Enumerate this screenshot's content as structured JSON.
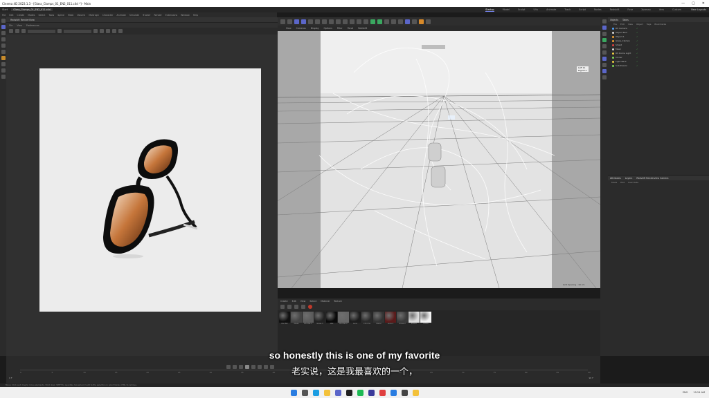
{
  "window": {
    "title": "Cinema 4D 2023.1.3 - [Glass_Clamps_01_EN2_011.c4d *] - Main",
    "controls": [
      "—",
      "▢",
      "✕"
    ]
  },
  "menubar": {
    "items": [
      "File",
      "Edit",
      "Create",
      "Modes",
      "Select",
      "Tools",
      "Spline",
      "Mesh",
      "Volume",
      "MoGraph",
      "Character",
      "Animate",
      "Simulate",
      "Tracker",
      "Render",
      "Extensions",
      "Window",
      "Help"
    ],
    "tabs": [
      "Start",
      "Glass_Clamps_01_EN2_011.c4d"
    ],
    "layout_tabs": [
      "Startup",
      "Model",
      "Sculpt",
      "UVs",
      "Animate",
      "Track",
      "Script",
      "Nodes",
      "Redshift",
      "Fuse",
      "Xpresso",
      "Vers",
      "Custom"
    ],
    "active_layout": "Startup",
    "new_layouts": "New Layouts"
  },
  "render_view": {
    "title": "Redshift RenderView",
    "menu": [
      "File",
      "View",
      "Preferences"
    ],
    "status_text": "Bmp 783/783x800x800 (w/Mo) Progressive 100% Samples 0.0 (Fe)0 100Final 1000 Stats 00:01:53 Total (Object) 0.0 mb ETA 0"
  },
  "viewport": {
    "menu": [
      "View",
      "Cameras",
      "Display",
      "Options",
      "Filter",
      "Panel",
      "Redshift"
    ],
    "label_top": "Default Camera",
    "label_right": [
      "Left 11",
      "Right 11"
    ],
    "zoom": "Grid Spacing : 10 cm"
  },
  "material_manager": {
    "menu": [
      "Create",
      "Edit",
      "View",
      "Select",
      "Material",
      "Texture"
    ],
    "materials": [
      {
        "name": "RS Mat",
        "color": "#111111"
      },
      {
        "name": "Glass",
        "color": "#444444"
      },
      {
        "name": "RS Mat.1",
        "color": "#5b5b5b"
      },
      {
        "name": "Glass.1",
        "color": "#222222"
      },
      {
        "name": "Mat",
        "color": "#0a0a0a"
      },
      {
        "name": "RS Mat.2",
        "color": "#666666"
      },
      {
        "name": "Lens",
        "color": "#1d1d1d"
      },
      {
        "name": "Chrome",
        "color": "#2a2a2a"
      },
      {
        "name": "Metal",
        "color": "#333333"
      },
      {
        "name": "Lens.1",
        "color": "#5a1a1a"
      },
      {
        "name": "Glass.2",
        "color": "#3a3a3a"
      },
      {
        "name": "Plastic",
        "color": "#dddddd"
      },
      {
        "name": "White",
        "color": "#f3f3f3"
      }
    ]
  },
  "objects_panel": {
    "tabs": [
      "Objects",
      "Takes"
    ],
    "menu": [
      "File",
      "Edit",
      "View",
      "Object",
      "Tags",
      "Bookmarks"
    ],
    "rows": [
      {
        "name": "RS Camera",
        "dot": "#4fa3ff"
      },
      {
        "name": "Object Null",
        "dot": "#d9d9d9"
      },
      {
        "name": "Object.1",
        "dot": "#f0a030"
      },
      {
        "name": "Glass_Clamps",
        "dot": "#f0a030"
      },
      {
        "name": "Shield",
        "dot": "#e04040"
      },
      {
        "name": "Mask",
        "dot": "#d9d9d9"
      },
      {
        "name": "RS Dome Light",
        "dot": "#f0d040"
      },
      {
        "name": "Cloner",
        "dot": "#7ed957"
      },
      {
        "name": "Light Back",
        "dot": "#f0d040"
      },
      {
        "name": "Subdivision",
        "dot": "#7ed957"
      }
    ]
  },
  "attributes_panel": {
    "tabs": [
      "Attributes",
      "Layers",
      "Redshift Renderview Camera"
    ],
    "menu": [
      "Mode",
      "Edit",
      "User Data"
    ]
  },
  "timeline": {
    "ticks": [
      "0",
      "5",
      "10",
      "15",
      "20",
      "25",
      "30",
      "35",
      "40",
      "45",
      "50",
      "55",
      "60",
      "65",
      "70",
      "75",
      "80",
      "85",
      "90"
    ],
    "frame_left": "0 F",
    "frame_right": "90 F",
    "status": "Frame 0  Selection Mode"
  },
  "captions": {
    "english": "so honestly this is one of my favorite",
    "chinese": "老实说，这是我最喜欢的一个，"
  },
  "statusbar": {
    "text": "Move: Click and drag to move elements. Hold down SHIFT to quantize movement / add to the selection in point mode, CTRL to remove."
  },
  "taskbar": {
    "icons": [
      {
        "name": "windows",
        "color": "#2a7de1"
      },
      {
        "name": "search",
        "color": "#555555"
      },
      {
        "name": "edge",
        "color": "#1b9de2"
      },
      {
        "name": "explorer",
        "color": "#f3c13a"
      },
      {
        "name": "app1",
        "color": "#5b66c9"
      },
      {
        "name": "app2",
        "color": "#1f1f1f"
      },
      {
        "name": "spotify",
        "color": "#1db954"
      },
      {
        "name": "app3",
        "color": "#3a3a9a"
      },
      {
        "name": "app4",
        "color": "#e04040"
      },
      {
        "name": "app5",
        "color": "#2a7de1"
      },
      {
        "name": "app6",
        "color": "#444444"
      },
      {
        "name": "app7",
        "color": "#f3c13a"
      }
    ],
    "tray": [
      "ENG",
      "10:24 AM"
    ]
  }
}
